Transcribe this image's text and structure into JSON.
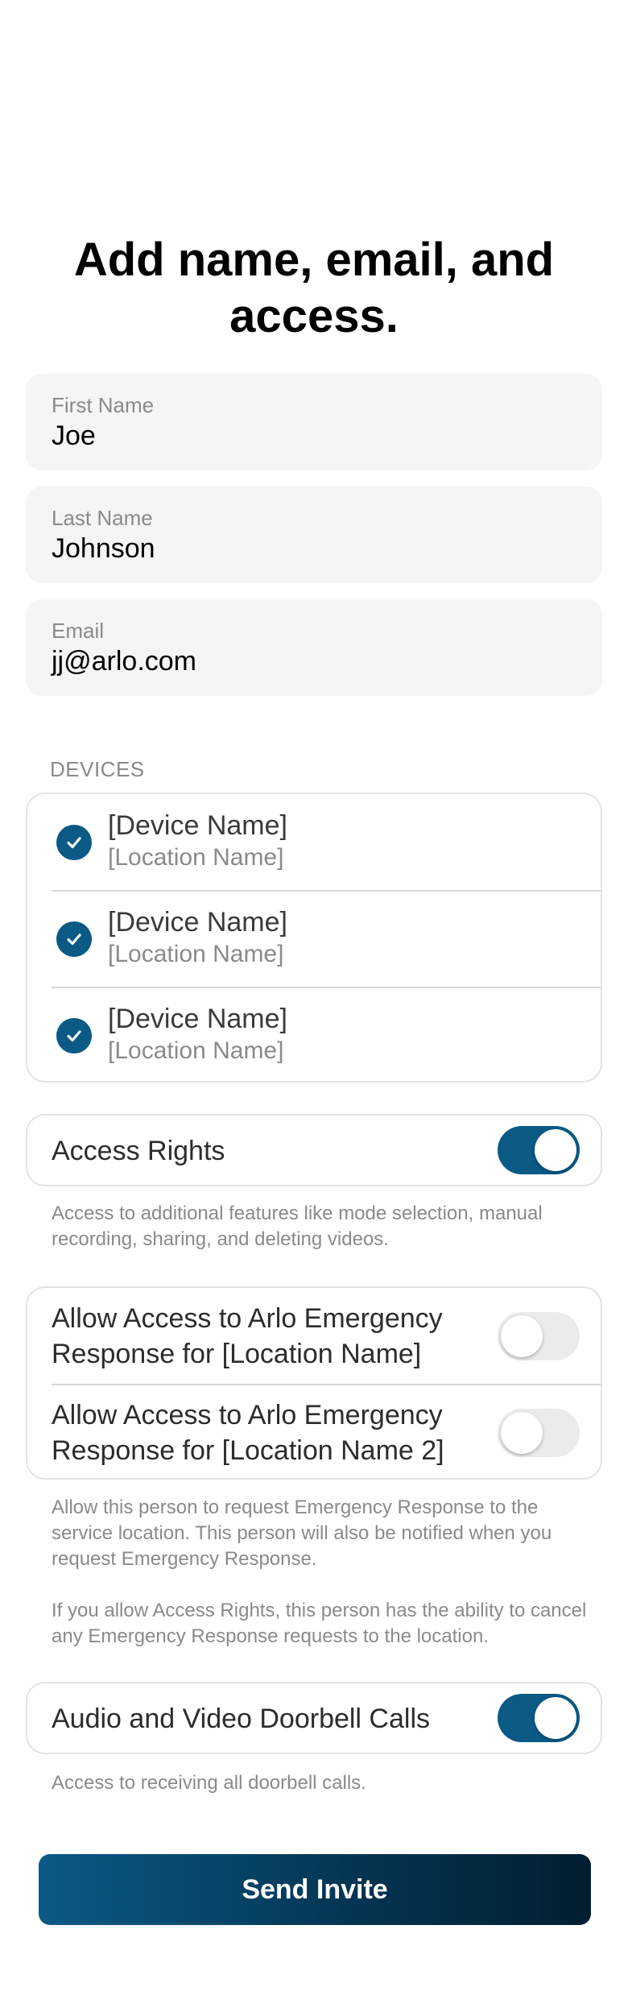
{
  "header": {
    "title": "Add name, email, and access."
  },
  "form": {
    "first_name": {
      "label": "First Name",
      "value": "Joe"
    },
    "last_name": {
      "label": "Last Name",
      "value": "Johnson"
    },
    "email": {
      "label": "Email",
      "value": "jj@arlo.com"
    }
  },
  "devices": {
    "section_label": "DEVICES",
    "items": [
      {
        "name": "[Device Name]",
        "location": "[Location Name]",
        "checked": true
      },
      {
        "name": "[Device Name]",
        "location": "[Location Name]",
        "checked": true
      },
      {
        "name": "[Device Name]",
        "location": "[Location Name]",
        "checked": true
      }
    ]
  },
  "access_rights": {
    "label": "Access Rights",
    "enabled": true,
    "note": "Access to additional features like mode selection, manual recording, sharing, and deleting videos."
  },
  "emergency": {
    "items": [
      {
        "label": "Allow Access to Arlo Emergency Response for [Location Name]",
        "enabled": false
      },
      {
        "label": "Allow Access to Arlo Emergency Response for [Location Name 2]",
        "enabled": false
      }
    ],
    "note1": "Allow this person to request Emergency Response to the service location. This person will also be notified when you request Emergency Response.",
    "note2": "If you allow Access Rights, this person has the ability to cancel any Emergency Response requests to the location."
  },
  "doorbell": {
    "label": "Audio and Video Doorbell Calls",
    "enabled": true,
    "note": "Access to receiving all doorbell calls."
  },
  "actions": {
    "send_invite": "Send Invite"
  },
  "colors": {
    "accent": "#0a5a85",
    "field_bg": "#f5f5f7"
  }
}
